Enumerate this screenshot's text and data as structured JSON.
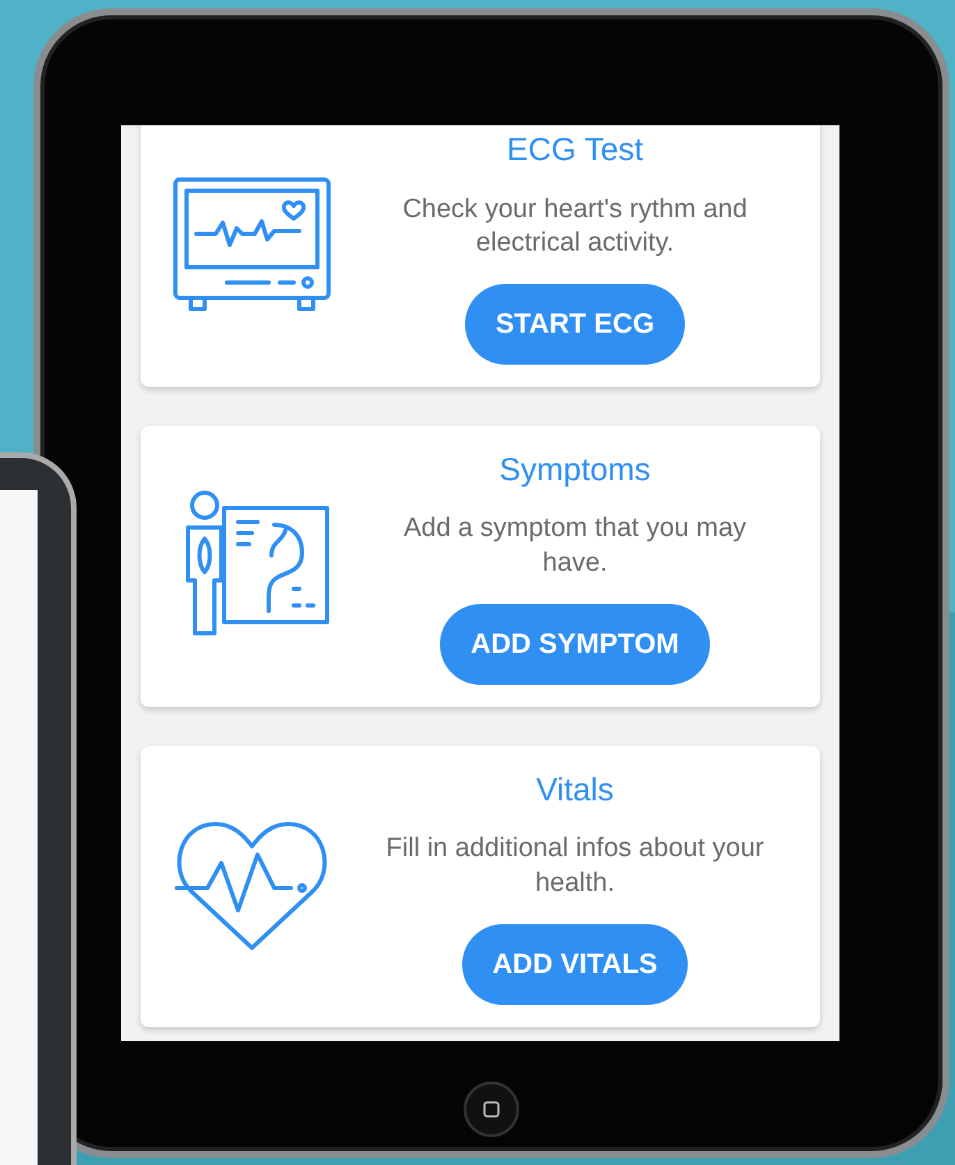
{
  "cards": [
    {
      "kind": "monitor",
      "title": "ECG Test",
      "description": "Check your heart's rythm and electrical activity.",
      "button": "START ECG"
    },
    {
      "kind": "anatomy",
      "title": "Symptoms",
      "description": "Add a symptom that you may have.",
      "button": "ADD SYMPTOM"
    },
    {
      "kind": "heart",
      "title": "Vitals",
      "description": "Fill in additional infos about your health.",
      "button": "ADD VITALS"
    }
  ]
}
